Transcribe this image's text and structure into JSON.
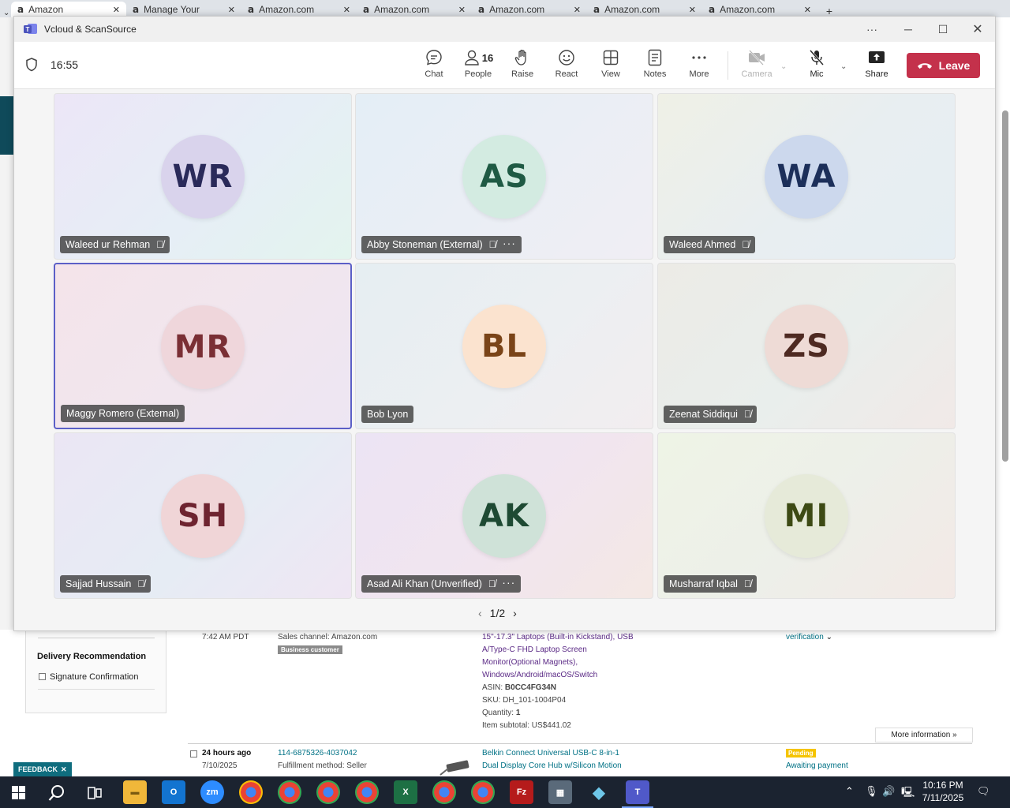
{
  "browser": {
    "tabs": [
      {
        "title": "Amazon",
        "active": true
      },
      {
        "title": "Manage Your"
      },
      {
        "title": "Amazon.com"
      },
      {
        "title": "Amazon.com"
      },
      {
        "title": "Amazon.com"
      },
      {
        "title": "Amazon.com"
      },
      {
        "title": "Amazon.com"
      }
    ],
    "page": {
      "delivery_recommendation": "Delivery Recommendation",
      "signature_confirmation": "Signature Confirmation",
      "order1": {
        "time": "7:42 AM PDT",
        "sales_channel": "Sales channel: Amazon.com",
        "business_badge": "Business customer",
        "product_lines": [
          "15\"-17.3\" Laptops (Built-in Kickstand), USB",
          "A/Type-C FHD Laptop Screen",
          "Monitor(Optional Magnets),",
          "Windows/Android/macOS/Switch"
        ],
        "asin_label": "ASIN:",
        "asin": "B0CC4FG34N",
        "sku": "SKU: DH_101-1004P04",
        "quantity_label": "Quantity:",
        "quantity": "1",
        "subtotal": "Item subtotal: US$441.02",
        "status_link": "verification"
      },
      "more_information": "More information",
      "order2": {
        "age": "24 hours ago",
        "date": "7/10/2025",
        "order_id": "114-6875326-4037042",
        "fulfillment": "Fulfillment method: Seller",
        "product_lines": [
          "Belkin Connect Universal USB-C 8-in-1",
          "Dual Display Core Hub w/Silicon Motion"
        ],
        "status_badge": "Pending",
        "status_text": "Awaiting payment"
      },
      "feedback": "FEEDBACK"
    }
  },
  "teams": {
    "window_title": "Vcloud & ScanSource",
    "timer": "16:55",
    "toolbar": {
      "chat": "Chat",
      "people": "People",
      "people_count": "16",
      "raise": "Raise",
      "react": "React",
      "view": "View",
      "notes": "Notes",
      "more": "More",
      "camera": "Camera",
      "mic": "Mic",
      "share": "Share",
      "leave": "Leave"
    },
    "participants": [
      {
        "initials": "WR",
        "name": "Waleed ur Rehman",
        "muted": true
      },
      {
        "initials": "AS",
        "name": "Abby Stoneman (External)",
        "muted": true,
        "more": true
      },
      {
        "initials": "WA",
        "name": "Waleed Ahmed",
        "muted": true
      },
      {
        "initials": "MR",
        "name": "Maggy Romero (External)",
        "muted": false,
        "active": true
      },
      {
        "initials": "BL",
        "name": "Bob Lyon",
        "muted": false
      },
      {
        "initials": "ZS",
        "name": "Zeenat Siddiqui",
        "muted": true
      },
      {
        "initials": "SH",
        "name": "Sajjad Hussain",
        "muted": true
      },
      {
        "initials": "AK",
        "name": "Asad Ali Khan (Unverified)",
        "muted": true,
        "more": true
      },
      {
        "initials": "MI",
        "name": "Musharraf Iqbal",
        "muted": true
      }
    ],
    "pager": "1/2",
    "colors": {
      "accent": "#5b5fc7",
      "leave": "#c4314b"
    }
  },
  "taskbar": {
    "time": "10:16 PM",
    "date": "7/11/2025"
  }
}
